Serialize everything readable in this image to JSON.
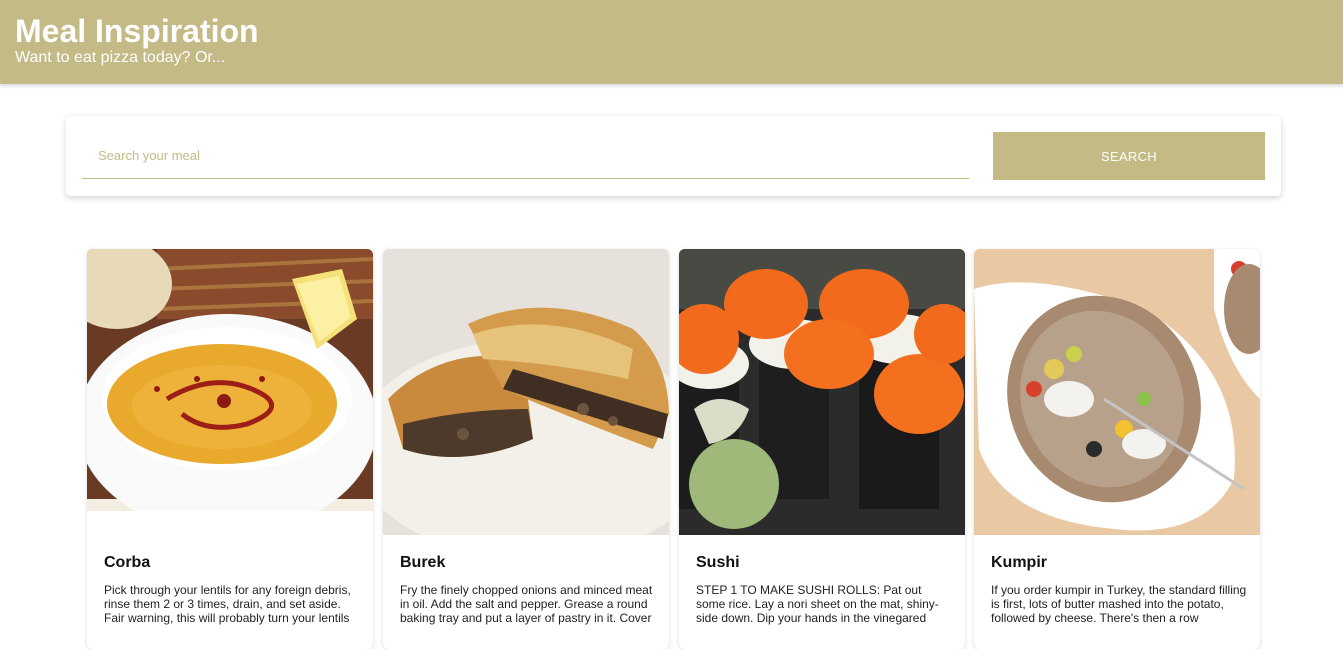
{
  "header": {
    "title": "Meal Inspiration",
    "subtitle": "Want to eat pizza today? Or..."
  },
  "search": {
    "placeholder": "Search your meal",
    "button_label": "SEARCH"
  },
  "colors": {
    "accent": "#c4ba86"
  },
  "meals": [
    {
      "name": "Corba",
      "description": "Pick through your lentils for any foreign debris, rinse them 2 or 3 times, drain, and set aside. Fair warning, this will probably turn your lentils",
      "image": "lentil-soup-image"
    },
    {
      "name": "Burek",
      "description": "Fry the finely chopped onions and minced meat in oil. Add the salt and pepper. Grease a round baking tray and put a layer of pastry in it. Cover",
      "image": "burek-pastry-image"
    },
    {
      "name": "Sushi",
      "description": "STEP 1 TO MAKE SUSHI ROLLS: Pat out some rice. Lay a nori sheet on the mat, shiny-side down. Dip your hands in the vinegared",
      "image": "sushi-rolls-image"
    },
    {
      "name": "Kumpir",
      "description": "If you order kumpir in Turkey, the standard filling is first, lots of butter mashed into the potato, followed by cheese. There's then a row",
      "image": "kumpir-potato-image"
    }
  ]
}
